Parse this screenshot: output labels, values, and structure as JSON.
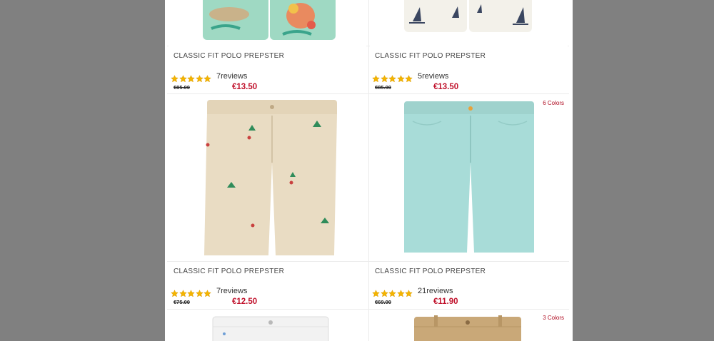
{
  "products": [
    {
      "title": "CLASSIC FIT POLO PREPSTER",
      "reviews": "7reviews",
      "old_price": "€85.00",
      "price": "€13.50",
      "rating": 5,
      "swatch": "#9fd9c3",
      "pattern": "hawaiian",
      "colors_label": ""
    },
    {
      "title": "CLASSIC FIT POLO PREPSTER",
      "reviews": "5reviews",
      "old_price": "€85.00",
      "price": "€13.50",
      "rating": 5,
      "swatch": "#f3f1ea",
      "pattern": "sailboat",
      "colors_label": ""
    },
    {
      "title": "CLASSIC FIT POLO PREPSTER",
      "reviews": "7reviews",
      "old_price": "€75.00",
      "price": "€12.50",
      "rating": 5,
      "swatch": "#e9dcc3",
      "pattern": "palm-embroidery",
      "colors_label": ""
    },
    {
      "title": "CLASSIC FIT POLO PREPSTER",
      "reviews": "21reviews",
      "old_price": "€69.00",
      "price": "€11.90",
      "rating": 5,
      "swatch": "#a8dcd8",
      "pattern": "solid",
      "colors_label": "6 Colors"
    },
    {
      "title": "",
      "reviews": "",
      "old_price": "",
      "price": "",
      "rating": 0,
      "swatch": "#f2f2f2",
      "pattern": "white-denim",
      "colors_label": ""
    },
    {
      "title": "",
      "reviews": "",
      "old_price": "",
      "price": "",
      "rating": 0,
      "swatch": "#c9a878",
      "pattern": "khaki",
      "colors_label": "3 Colors"
    }
  ],
  "colors": {
    "backdrop": "#808080",
    "price": "#c0112b",
    "star": "#f4b400",
    "colors_label": "#b00d22"
  },
  "icons": {
    "rating": "star-icon"
  }
}
